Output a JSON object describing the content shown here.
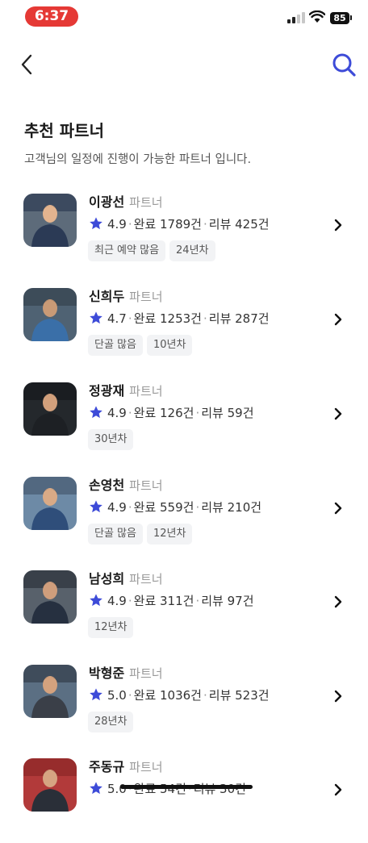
{
  "status_bar": {
    "time": "6:37",
    "battery": "85"
  },
  "nav": {
    "back_icon": "chevron-left-icon",
    "search_icon": "search-icon",
    "accent": "#3d4bd8"
  },
  "header": {
    "title": "추천 파트너",
    "description": "고객님의 일정에 진행이 가능한 파트너 입니다."
  },
  "partners": [
    {
      "name": "이광선",
      "role": "파트너",
      "rating": "4.9",
      "completed": "완료 1789건",
      "reviews": "리뷰 425건",
      "tags": [
        "최근 예약 많음",
        "24년차"
      ]
    },
    {
      "name": "신희두",
      "role": "파트너",
      "rating": "4.7",
      "completed": "완료 1253건",
      "reviews": "리뷰 287건",
      "tags": [
        "단골 많음",
        "10년차"
      ]
    },
    {
      "name": "정광재",
      "role": "파트너",
      "rating": "4.9",
      "completed": "완료 126건",
      "reviews": "리뷰 59건",
      "tags": [
        "30년차"
      ]
    },
    {
      "name": "손영천",
      "role": "파트너",
      "rating": "4.9",
      "completed": "완료 559건",
      "reviews": "리뷰 210건",
      "tags": [
        "단골 많음",
        "12년차"
      ]
    },
    {
      "name": "남성희",
      "role": "파트너",
      "rating": "4.9",
      "completed": "완료 311건",
      "reviews": "리뷰 97건",
      "tags": [
        "12년차"
      ]
    },
    {
      "name": "박형준",
      "role": "파트너",
      "rating": "5.0",
      "completed": "완료 1036건",
      "reviews": "리뷰 523건",
      "tags": [
        "28년차"
      ]
    },
    {
      "name": "주동규",
      "role": "파트너",
      "rating": "5.0",
      "completed": "완료 54건",
      "reviews": "리뷰 30건",
      "tags": []
    }
  ],
  "colors": {
    "star": "#3d4bd8",
    "time_pill": "#e53935"
  }
}
